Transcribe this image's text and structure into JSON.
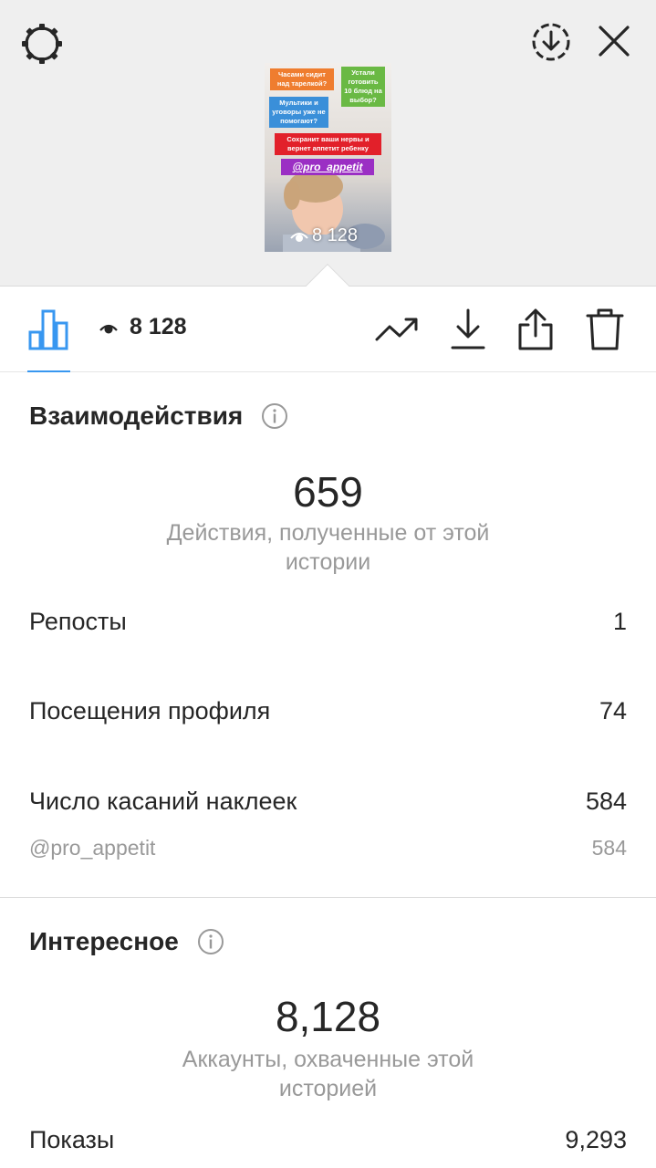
{
  "top": {
    "settings_icon": "gear-icon",
    "download_icon": "download-circle-icon",
    "close_icon": "close-icon"
  },
  "thumbnail": {
    "sticker_1": "Часами сидит над тарелкой?",
    "sticker_2": "Устали готовить 10 блюд на выбор?",
    "sticker_3": "Мультики и уговоры уже не помогают?",
    "sticker_4": "Сохранит ваши нервы и вернет аппетит ребенку",
    "sticker_5": "@pro_appetit",
    "views": "8 128"
  },
  "toolbar": {
    "views": "8 128",
    "accent": "#3897f0"
  },
  "interactions": {
    "title": "Взаимодействия",
    "total": "659",
    "caption": "Действия, полученные от этой истории",
    "rows": [
      {
        "label": "Репосты",
        "value": "1"
      },
      {
        "label": "Посещения профиля",
        "value": "74"
      },
      {
        "label": "Число касаний наклеек",
        "value": "584"
      }
    ],
    "sticker_row": {
      "label": "@pro_appetit",
      "value": "584"
    }
  },
  "discovery": {
    "title": "Интересное",
    "total": "8,128",
    "caption": "Аккаунты, охваченные этой историей",
    "rows": [
      {
        "label": "Показы",
        "value": "9,293"
      }
    ]
  }
}
